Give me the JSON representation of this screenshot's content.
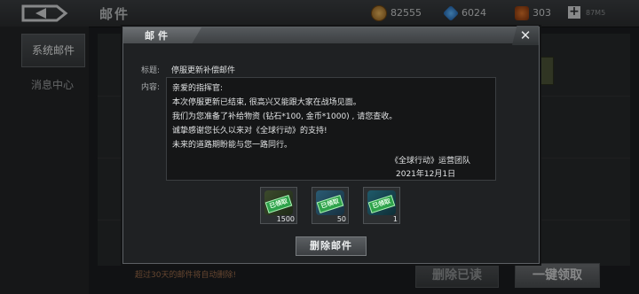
{
  "header": {
    "page_title": "邮件",
    "gold": "82555",
    "diamonds": "6024",
    "medals": "303",
    "signal": "87M5"
  },
  "sidebar": {
    "items": [
      {
        "label": "系统邮件",
        "active": true
      },
      {
        "label": "消息中心",
        "active": false
      }
    ]
  },
  "footer": {
    "note": "超过30天的邮件将自动删除!",
    "delete_read": "删除已读",
    "claim_all": "一键领取"
  },
  "modal": {
    "title": "邮件",
    "close": "✕",
    "subject_label": "标题:",
    "subject": "停服更新补偿邮件",
    "content_label": "内容:",
    "content_lines": [
      "亲爱的指挥官:",
      "本次停服更新已结束, 很高兴又能跟大家在战场见面。",
      "我们为您准备了补给物资 (钻石*100, 金币*1000) , 请您查收。",
      "诚挚感谢您长久以来对《全球行动》的支持!",
      "未来的道路期盼能与您一路同行。"
    ],
    "signature": "《全球行动》运营团队",
    "date": "2021年12月1日",
    "items": [
      {
        "icon": "supply-crate-icon",
        "stamp": "已领取",
        "quantity": "1500"
      },
      {
        "icon": "diamond-crate-icon",
        "stamp": "已领取",
        "quantity": "50"
      },
      {
        "icon": "coin-crate-icon",
        "stamp": "已领取",
        "quantity": "1"
      }
    ],
    "delete_button": "删除邮件"
  }
}
